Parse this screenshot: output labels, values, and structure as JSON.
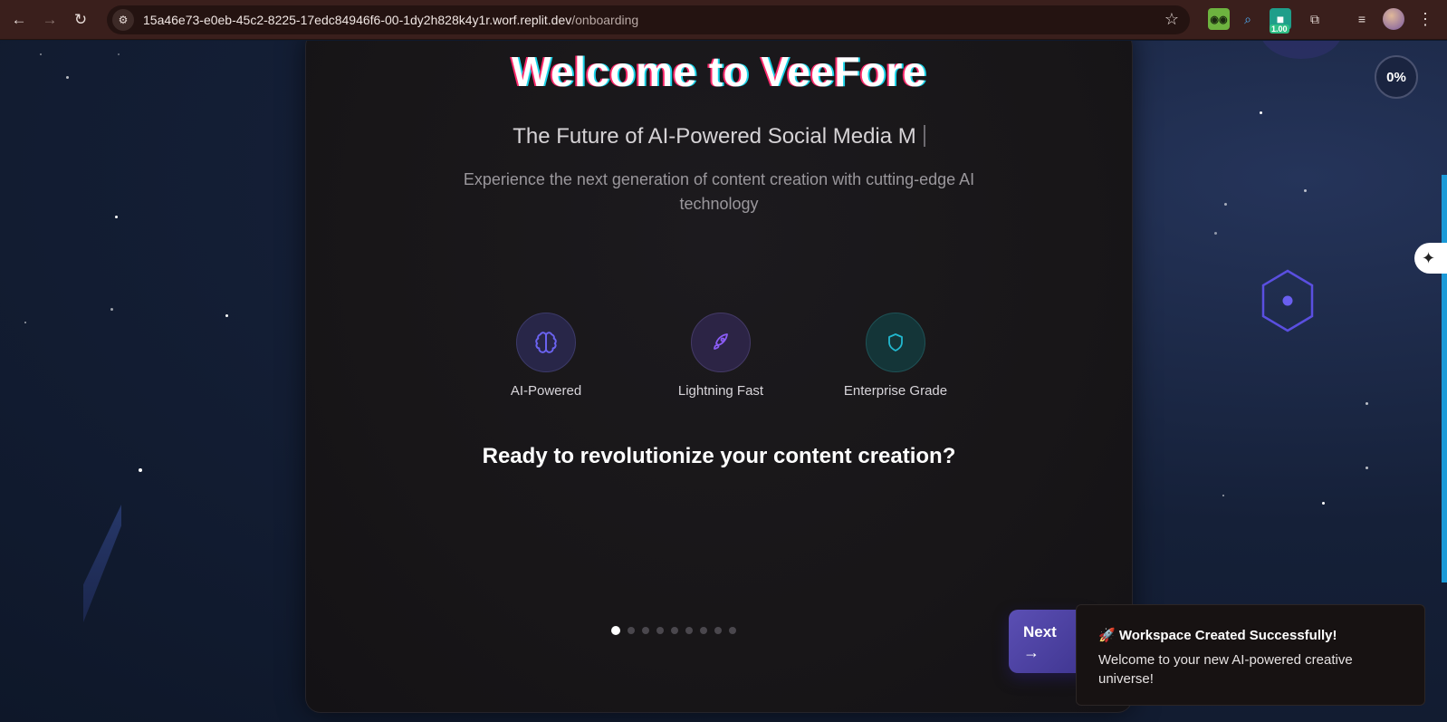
{
  "browser": {
    "url_host": "15a46e73-e0eb-45c2-8225-17edc84946f6-00-1dy2h828k4y1r.worf.replit.dev",
    "url_path": "/onboarding",
    "back_icon": "arrow-left-icon",
    "forward_icon": "arrow-right-icon",
    "reload_icon": "reload-icon",
    "extension_badge": "1.00"
  },
  "onboarding": {
    "heading": "Welcome to VeeFore",
    "tagline": "The Future of AI-Powered Social Media M",
    "subtitle": "Experience the next generation of content creation with cutting-edge AI technology",
    "features": [
      {
        "label": "AI-Powered",
        "icon": "brain-icon",
        "color": "#6b63f0"
      },
      {
        "label": "Lightning Fast",
        "icon": "rocket-icon",
        "color": "#8b5cf6"
      },
      {
        "label": "Enterprise Grade",
        "icon": "shield-icon",
        "color": "#22b8cf"
      }
    ],
    "cta_question": "Ready to revolutionize your content creation?",
    "steps_total": 9,
    "current_step": 1,
    "next_label": "Next",
    "next_arrow": "→"
  },
  "progress": {
    "percent_label": "0%"
  },
  "toast": {
    "title": "🚀 Workspace Created Successfully!",
    "message": "Welcome to your new AI-powered creative universe!"
  },
  "colors": {
    "accent": "#5b4fb4",
    "background": "#0f1a2e",
    "card": "#181618"
  }
}
